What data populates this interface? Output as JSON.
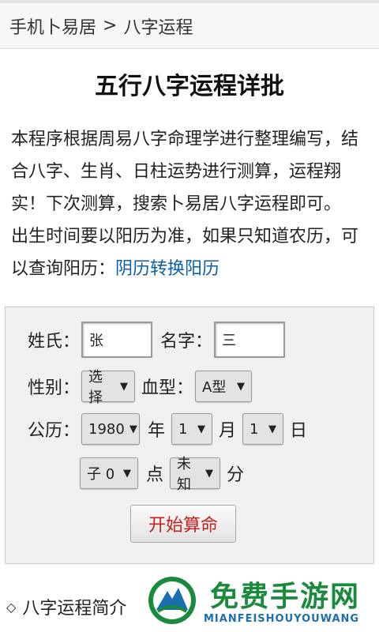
{
  "breadcrumb": {
    "home": "手机卜易居",
    "separator": ">",
    "current": "八字运程"
  },
  "page_title": "五行八字运程详批",
  "intro": {
    "line1": "本程序根据周易八字命理学进行整理编写，结合八字、生肖、日柱运势进行测算，运程翔实！下次测算，搜索卜易居八字运程即可。",
    "line2_prefix": "出生时间要以阳历为准，如果只知道农历，可以查询阳历：",
    "line2_link": "阴历转换阳历"
  },
  "form": {
    "surname_label": "姓氏：",
    "surname_value": "张",
    "name_label": "名字：",
    "name_value": "三",
    "gender_label": "性别：",
    "gender_value": "选择",
    "blood_label": "血型：",
    "blood_value": "A型",
    "date_label": "公历：",
    "year_value": "1980",
    "year_unit": "年",
    "month_value": "1",
    "month_unit": "月",
    "day_value": "1",
    "day_unit": "日",
    "hour_value": "子 0",
    "hour_unit": "点",
    "minute_value": "未知",
    "minute_unit": "分",
    "submit_label": "开始算命"
  },
  "section_heading": "八字运程简介",
  "watermark": {
    "title": "免费手游网",
    "subtitle": "MIANFEISHOUYOUWANG"
  },
  "colors": {
    "link": "#0a5fa8",
    "submit_text": "#c41e1e",
    "watermark_green": "#1a8a3c",
    "watermark_blue": "#1a6fb0"
  },
  "icons": {
    "select_arrow": "▼",
    "section_marker": "◇"
  }
}
